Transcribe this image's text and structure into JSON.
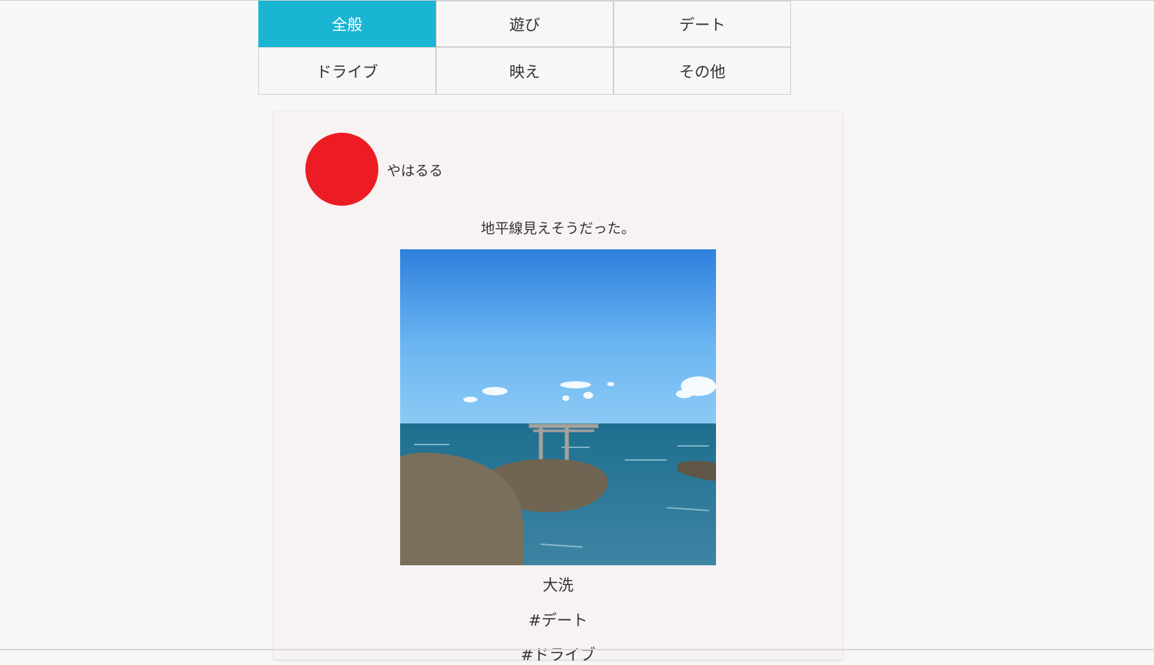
{
  "tabs": {
    "row1": [
      {
        "label": "全般",
        "active": true
      },
      {
        "label": "遊び",
        "active": false
      },
      {
        "label": "デート",
        "active": false
      }
    ],
    "row2": [
      {
        "label": "ドライブ",
        "active": false
      },
      {
        "label": "映え",
        "active": false
      },
      {
        "label": "その他",
        "active": false
      }
    ]
  },
  "post": {
    "author": "やはるる",
    "avatar_color": "#ed1c24",
    "text": "地平線見えそうだった。",
    "location": "大洗",
    "tags": [
      "#デート",
      "#ドライブ"
    ]
  },
  "colors": {
    "accent": "#1bb5d4",
    "background": "#f7f7f5",
    "card": "#f8f3f3"
  }
}
